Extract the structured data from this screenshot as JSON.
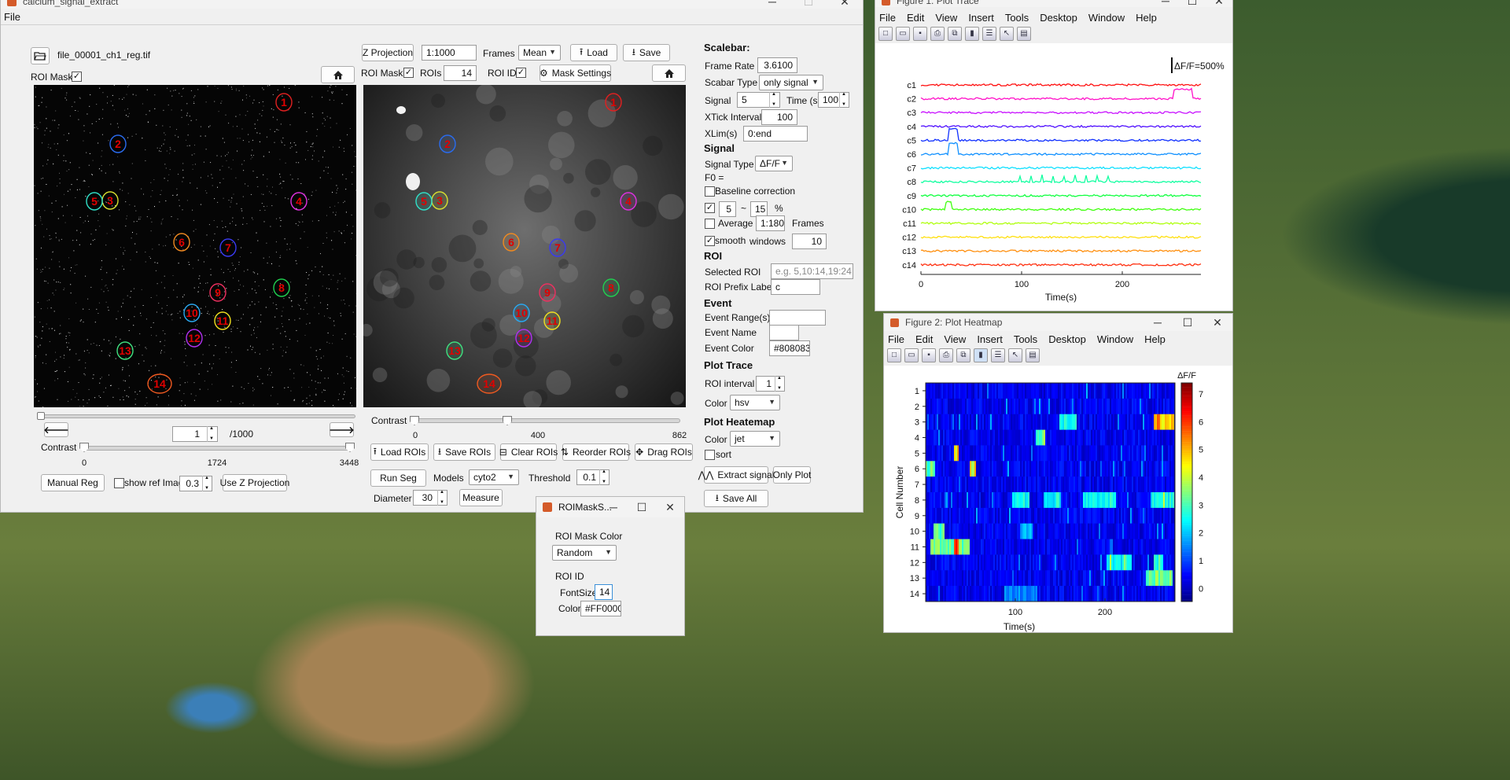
{
  "main_window": {
    "title": "calcium_signal_extract",
    "menu": [
      "File"
    ],
    "file_name": "file_00001_ch1_reg.tif",
    "roi_mask_left_label": "ROI Mask",
    "z_projection_btn": "Z Projection",
    "range_value": "1:1000",
    "frames_label": "Frames",
    "frames_mode": "Mean",
    "load_btn": "Load",
    "save_btn": "Save",
    "roi_mask_label": "ROI Mask",
    "rois_label": "ROIs",
    "rois_count": "14",
    "roi_id_label": "ROI ID",
    "mask_settings_btn": "Mask Settings",
    "frame_value": "1",
    "frame_total": "/1000",
    "contrast_label": "Contrast",
    "left_contrast_ticks": [
      "0",
      "1724",
      "3448"
    ],
    "right_contrast_ticks": [
      "0",
      "400",
      "862"
    ],
    "manual_reg_btn": "Manual Reg",
    "show_ref_label": "show ref Image",
    "ref_value": "0.3",
    "use_z_btn": "Use Z Projection",
    "load_rois_btn": "Load ROIs",
    "save_rois_btn": "Save ROIs",
    "clear_rois_btn": "Clear ROIs",
    "reorder_rois_btn": "Reorder ROIs",
    "drag_rois_btn": "Drag ROIs",
    "run_seg_btn": "Run Seg",
    "models_label": "Models",
    "models_value": "cyto2",
    "threshold_label": "Threshold",
    "threshold_value": "0.1",
    "diameter_label": "Diameter",
    "diameter_value": "30",
    "measure_btn": "Measure",
    "rois": [
      {
        "id": "1",
        "color": "#e02020"
      },
      {
        "id": "2",
        "color": "#2a6cf0"
      },
      {
        "id": "3",
        "color": "#d8e030"
      },
      {
        "id": "4",
        "color": "#e030e0"
      },
      {
        "id": "5",
        "color": "#30e0c8"
      },
      {
        "id": "6",
        "color": "#f08a20"
      },
      {
        "id": "7",
        "color": "#3a3af0"
      },
      {
        "id": "8",
        "color": "#20d050"
      },
      {
        "id": "9",
        "color": "#f03060"
      },
      {
        "id": "10",
        "color": "#2aa8f0"
      },
      {
        "id": "11",
        "color": "#f0e020"
      },
      {
        "id": "12",
        "color": "#b030f0"
      },
      {
        "id": "13",
        "color": "#40e080"
      },
      {
        "id": "14",
        "color": "#f05a20"
      }
    ]
  },
  "settings": {
    "scalebar_heading": "Scalebar:",
    "frame_rate_label": "Frame Rate",
    "frame_rate_value": "3.6100",
    "scalebar_type_label": "Scabar Type",
    "scalebar_type_value": "only signal",
    "signal_label": "Signal",
    "signal_value": "5",
    "time_label": "Time (s)",
    "time_value": "100",
    "xtick_label": "XTick Interval(s)",
    "xtick_value": "100",
    "xlim_label": "XLim(s)",
    "xlim_value": "0:end",
    "signal_heading": "Signal",
    "signal_type_label": "Signal Type",
    "signal_type_value": "ΔF/F",
    "f0_label": "F0 =",
    "baseline_label": "Baseline correction",
    "pct_low": "5",
    "tilde": "~",
    "pct_high": "15",
    "pct_unit": "%",
    "average_label": "Average",
    "average_value": "1:180",
    "average_unit": "Frames",
    "smooth_label": "smooth",
    "windows_label": "windows",
    "windows_value": "10",
    "roi_heading": "ROI",
    "selected_roi_label": "Selected ROI",
    "selected_roi_placeholder": "e.g.  5,10:14,19:24",
    "prefix_label": "ROI Prefix Label",
    "prefix_value": "c",
    "event_heading": "Event",
    "event_range_label": "Event Range(s)",
    "event_name_label": "Event Name",
    "event_color_label": "Event Color",
    "event_color_value": "#808083",
    "plot_trace_heading": "Plot Trace",
    "roi_interval_label": "ROI interval",
    "roi_interval_value": "1",
    "color_label": "Color",
    "trace_color_value": "hsv",
    "plot_heatmap_heading": "Plot Heatemap",
    "heatmap_color_value": "jet",
    "sort_label": "sort",
    "extract_btn": "Extract signal",
    "only_plot_btn": "Only Plot",
    "save_all_btn": "Save All"
  },
  "figure1": {
    "title": "Figure 1: Plot Trace",
    "menu": [
      "File",
      "Edit",
      "View",
      "Insert",
      "Tools",
      "Desktop",
      "Window",
      "Help"
    ],
    "scale_label": "ΔF/F=500%",
    "xlabel": "Time(s)",
    "xticks": [
      "0",
      "100",
      "200"
    ],
    "traces": [
      {
        "label": "c1",
        "color": "#ff1010"
      },
      {
        "label": "c2",
        "color": "#ff10c8"
      },
      {
        "label": "c3",
        "color": "#c810ff"
      },
      {
        "label": "c4",
        "color": "#5010ff"
      },
      {
        "label": "c5",
        "color": "#1030ff"
      },
      {
        "label": "c6",
        "color": "#1090ff"
      },
      {
        "label": "c7",
        "color": "#10e0ff"
      },
      {
        "label": "c8",
        "color": "#10ffa0"
      },
      {
        "label": "c9",
        "color": "#10ff40"
      },
      {
        "label": "c10",
        "color": "#40ff10"
      },
      {
        "label": "c11",
        "color": "#b0ff10"
      },
      {
        "label": "c12",
        "color": "#ffe010"
      },
      {
        "label": "c13",
        "color": "#ff9010"
      },
      {
        "label": "c14",
        "color": "#ff3010"
      }
    ]
  },
  "figure2": {
    "title": "Figure 2: Plot Heatmap",
    "menu": [
      "File",
      "Edit",
      "View",
      "Insert",
      "Tools",
      "Desktop",
      "Window",
      "Help"
    ],
    "xlabel": "Time(s)",
    "ylabel": "Cell Number",
    "colorbar_label": "ΔF/F",
    "colorbar_ticks": [
      "7",
      "6",
      "5",
      "4",
      "3",
      "2",
      "1",
      "0"
    ],
    "xticks": [
      "100",
      "200"
    ],
    "rows": [
      "1",
      "2",
      "3",
      "4",
      "5",
      "6",
      "7",
      "8",
      "9",
      "10",
      "11",
      "12",
      "13",
      "14"
    ]
  },
  "dialog": {
    "title": "ROIMaskS...",
    "mask_color_label": "ROI Mask Color",
    "mask_color_value": "Random",
    "roi_id_label": "ROI ID",
    "fontsize_label": "FontSize",
    "fontsize_value": "14",
    "color_label": "Color",
    "color_value": "#FF0000"
  }
}
